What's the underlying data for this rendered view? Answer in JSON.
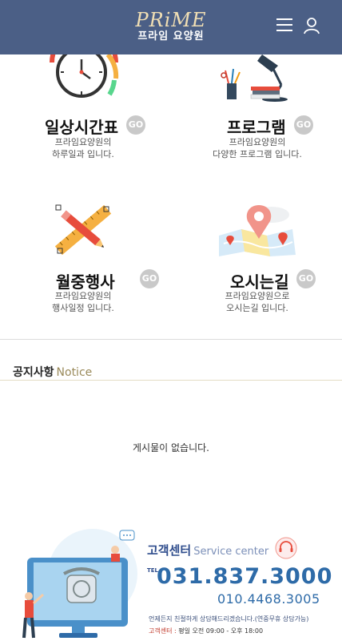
{
  "header": {
    "logo_en": "PRiME",
    "logo_ko": "프라임 요양원",
    "menu_icon": "hamburger-icon",
    "user_icon": "user-icon"
  },
  "tiles": [
    {
      "title": "일상시간표",
      "go": "GO",
      "desc1": "프라임요양원의",
      "desc2": "하루일과 입니다.",
      "icon": "clock-icon"
    },
    {
      "title": "프로그램",
      "go": "GO",
      "desc1": "프라임요양원의",
      "desc2": "다양한 프로그램 입니다.",
      "icon": "desk-lamp-icon"
    },
    {
      "title": "월중행사",
      "go": "GO",
      "desc1": "프라임요양원의",
      "desc2": "행사일정 입니다.",
      "icon": "pencil-ruler-icon"
    },
    {
      "title": "오시는길",
      "go": "GO",
      "desc1": "프라임요양원으로",
      "desc2": "오시는길 입니다.",
      "icon": "map-pin-icon"
    }
  ],
  "notice": {
    "title": "공지사항",
    "subtitle": "Notice",
    "empty_text": "게시물이 없습니다."
  },
  "service": {
    "title": "고객센터",
    "subtitle": "Service center",
    "tel_label": "TEL",
    "phone_main": "031.837.3000",
    "phone_sub": "010.4468.3005",
    "note": "언제든지 친절하게 상담해드리겠습니다.(연중무휴 상담가능)",
    "hours_label": "고객센터 :",
    "hours": "평일 오전 09:00 - 오후 18:00",
    "colors": {
      "accent": "#2e6ba8",
      "header": "#4b5f86"
    }
  }
}
